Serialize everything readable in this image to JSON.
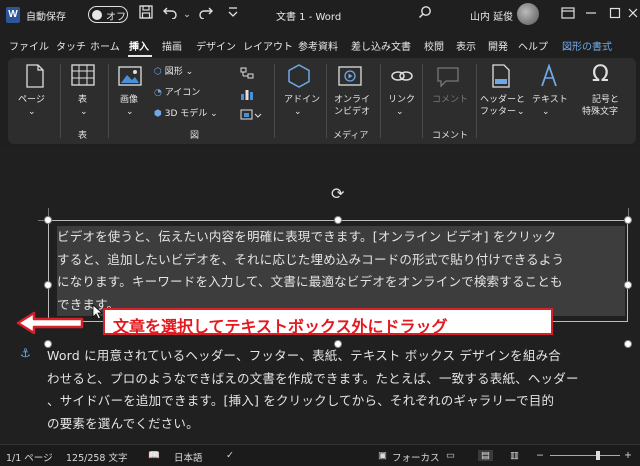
{
  "titlebar": {
    "logo_letter": "W",
    "autosave_label": "自動保存",
    "autosave_state": "オフ",
    "doc_title": "文書 1 - Word",
    "user_name": "山内 延俊"
  },
  "tabs": [
    {
      "label": "ファイル"
    },
    {
      "label": "タッチ"
    },
    {
      "label": "ホーム"
    },
    {
      "label": "挿入"
    },
    {
      "label": "描画"
    },
    {
      "label": "デザイン"
    },
    {
      "label": "レイアウト"
    },
    {
      "label": "参考資料"
    },
    {
      "label": "差し込み文書"
    },
    {
      "label": "校閲"
    },
    {
      "label": "表示"
    },
    {
      "label": "開発"
    },
    {
      "label": "ヘルプ"
    },
    {
      "label": "図形の書式"
    }
  ],
  "ribbon": {
    "page_label": "ページ",
    "table_label": "表",
    "table_group": "表",
    "images_label": "画像",
    "shapes_label": "図形",
    "icons_label": "アイコン",
    "model3d_label": "3D モデル",
    "illust_group": "図",
    "addins_label": "アドイン",
    "online_video_label_1": "オンライ",
    "online_video_label_2": "ンビデオ",
    "media_group": "メディア",
    "link_label": "リンク",
    "comment_label": "コメント",
    "comment_group": "コメント",
    "header_footer_label_1": "ヘッダーと",
    "header_footer_label_2": "フッター",
    "text_label": "テキスト",
    "symbols_label_1": "記号と",
    "symbols_label_2": "特殊文字"
  },
  "document": {
    "selected_lines": [
      "ビデオを使うと、伝えたい内容を明確に表現できます。[オンライン ビデオ] をクリック",
      "すると、追加したいビデオを、それに応じた埋め込みコードの形式で貼り付けできるよう",
      "になります。キーワードを入力して、文書に最適なビデオをオンラインで検索することも",
      "できます。"
    ],
    "body_lines": [
      "Word に用意されているヘッダー、フッター、表紙、テキスト ボックス デザインを組み合",
      "わせると、プロのようなできばえの文書を作成できます。たとえば、一致する表紙、ヘッダー",
      "、サイドバーを追加できます。[挿入] をクリックしてから、それぞれのギャラリーで目的",
      "の要素を選んでください。"
    ],
    "callout": "文章を選択してテキストボックス外にドラッグ"
  },
  "statusbar": {
    "page": "1/1 ページ",
    "words": "125/258 文字",
    "language": "日本語",
    "focus": "フォーカス"
  },
  "colors": {
    "accent": "#6fa8e6",
    "callout_red": "#e3191f",
    "word_blue": "#2b579a"
  }
}
